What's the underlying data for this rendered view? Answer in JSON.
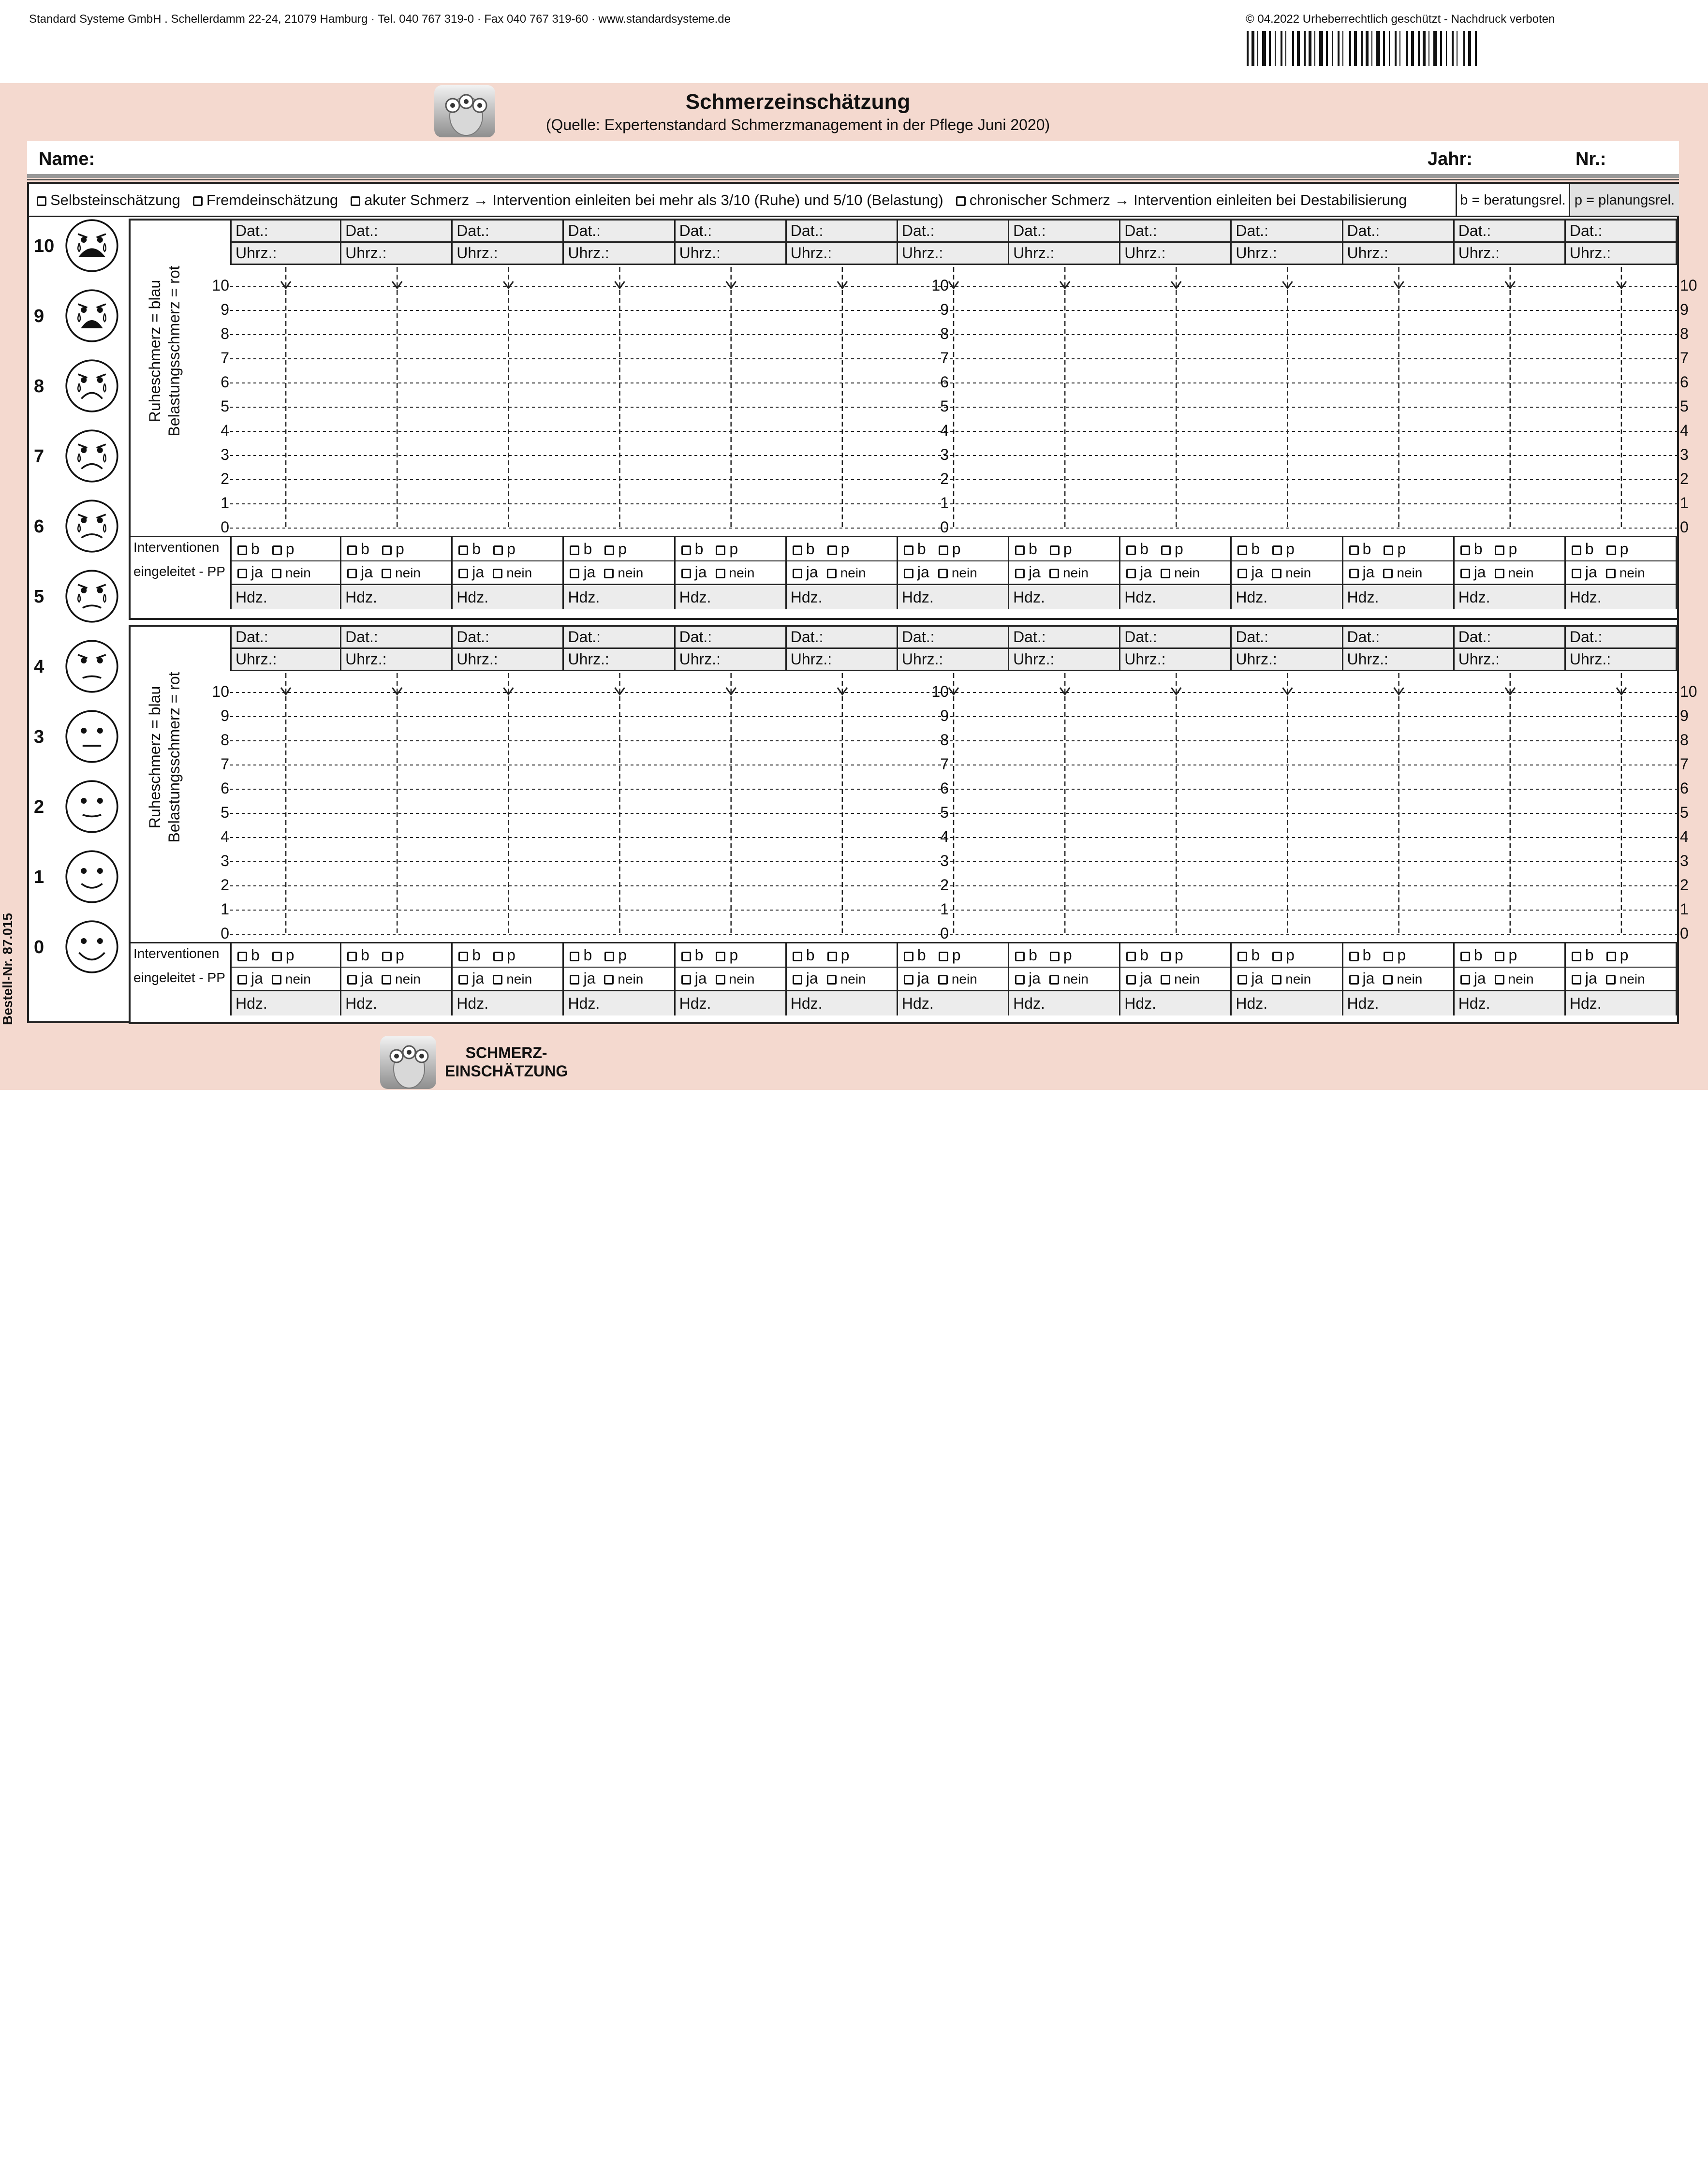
{
  "header": {
    "publisher": "Standard Systeme GmbH . Schellerdamm 22-24, 21079 Hamburg · Tel. 040 767 319-0 · Fax 040 767 319-60 · www.standardsysteme.de",
    "copyright": "© 04.2022 Urheberrechtlich geschützt - Nachdruck verboten",
    "title": "Schmerzeinschätzung",
    "subtitle": "(Quelle: Expertenstandard Schmerzmanagement in der Pflege Juni 2020)"
  },
  "namebar": {
    "name_label": "Name:",
    "year_label": "Jahr:",
    "nr_label": "Nr.:"
  },
  "legend": {
    "self": "Selbsteinschätzung",
    "other": "Fremdeinschätzung",
    "acute": "akuter Schmerz → Intervention einleiten bei mehr als 3/10 (Ruhe) und 5/10 (Belastung)",
    "chronic": "chronischer Schmerz → Intervention einleiten bei Destabilisierung",
    "b_def": "b = beratungsrel.",
    "p_def": "p = planungsrel."
  },
  "faces": [
    "10",
    "9",
    "8",
    "7",
    "6",
    "5",
    "4",
    "3",
    "2",
    "1",
    "0"
  ],
  "grid": {
    "date_label": "Dat.:",
    "time_label": "Uhrz.:",
    "hdz_label": "Hdz.",
    "axis_label_1": "Ruheschmerz = blau",
    "axis_label_2": "Belastungsschmerz = rot",
    "interventions_1": "Interventionen",
    "interventions_2": "eingeleitet - PP",
    "b": "b",
    "p": "p",
    "ja": "ja",
    "nein": "nein",
    "scale": [
      "10",
      "9",
      "8",
      "7",
      "6",
      "5",
      "4",
      "3",
      "2",
      "1",
      "0"
    ],
    "columns": 13
  },
  "footer": {
    "order_no": "Bestell-Nr. 87.015",
    "logo_text_1": "SCHMERZ-",
    "logo_text_2": "EINSCHÄTZUNG"
  }
}
